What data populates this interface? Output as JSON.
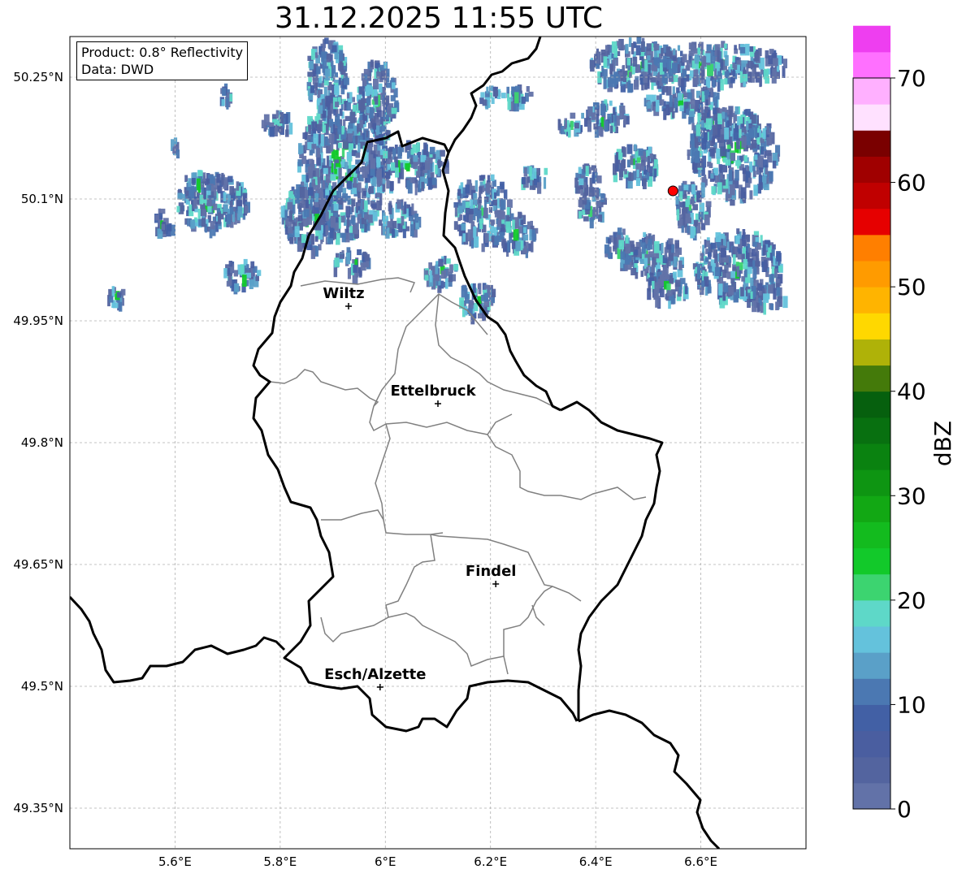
{
  "title": "31.12.2025 11:55 UTC",
  "info_box": {
    "product": "Product: 0.8° Reflectivity",
    "data": "Data: DWD"
  },
  "axes": {
    "lon_ticks": [
      "5.6°E",
      "5.8°E",
      "6°E",
      "6.2°E",
      "6.4°E",
      "6.6°E"
    ],
    "lat_ticks": [
      "50.25°N",
      "50.1°N",
      "49.95°N",
      "49.8°N",
      "49.65°N",
      "49.5°N",
      "49.35°N"
    ],
    "lon_values": [
      5.6,
      5.8,
      6.0,
      6.2,
      6.4,
      6.6
    ],
    "lat_values": [
      50.25,
      50.1,
      49.95,
      49.8,
      49.65,
      49.5,
      49.35
    ],
    "lon_range": [
      5.4,
      6.8
    ],
    "lat_range": [
      49.3,
      50.3
    ]
  },
  "cities": [
    {
      "name": "Wiltz",
      "lon": 5.93,
      "lat": 49.968
    },
    {
      "name": "Ettelbruck",
      "lon": 6.1,
      "lat": 49.848
    },
    {
      "name": "Findel",
      "lon": 6.21,
      "lat": 49.626
    },
    {
      "name": "Esch/Alzette",
      "lon": 5.99,
      "lat": 49.499
    }
  ],
  "radar_site": {
    "lon": 6.547,
    "lat": 50.11,
    "color": "#ff0000"
  },
  "colorbar": {
    "label": "dBZ",
    "ticks": [
      "0",
      "10",
      "20",
      "30",
      "40",
      "50",
      "60",
      "70"
    ],
    "min": 0,
    "max": 70,
    "step": 2.5,
    "colors": [
      "#6272a8",
      "#53649f",
      "#4a5ea0",
      "#4260a5",
      "#4b78b2",
      "#5aa0c8",
      "#64c2dc",
      "#5ed8c8",
      "#3cd470",
      "#12c92a",
      "#13bb1e",
      "#12a814",
      "#0e9512",
      "#0a8210",
      "#087010",
      "#06600e",
      "#447a0a",
      "#afb208",
      "#ffd800",
      "#ffb400",
      "#ff9b00",
      "#ff7f00",
      "#e60000",
      "#c00000",
      "#a00000",
      "#7a0000",
      "#ffe1ff",
      "#ffb0ff",
      "#ff70ff",
      "#ee3ef0"
    ]
  }
}
